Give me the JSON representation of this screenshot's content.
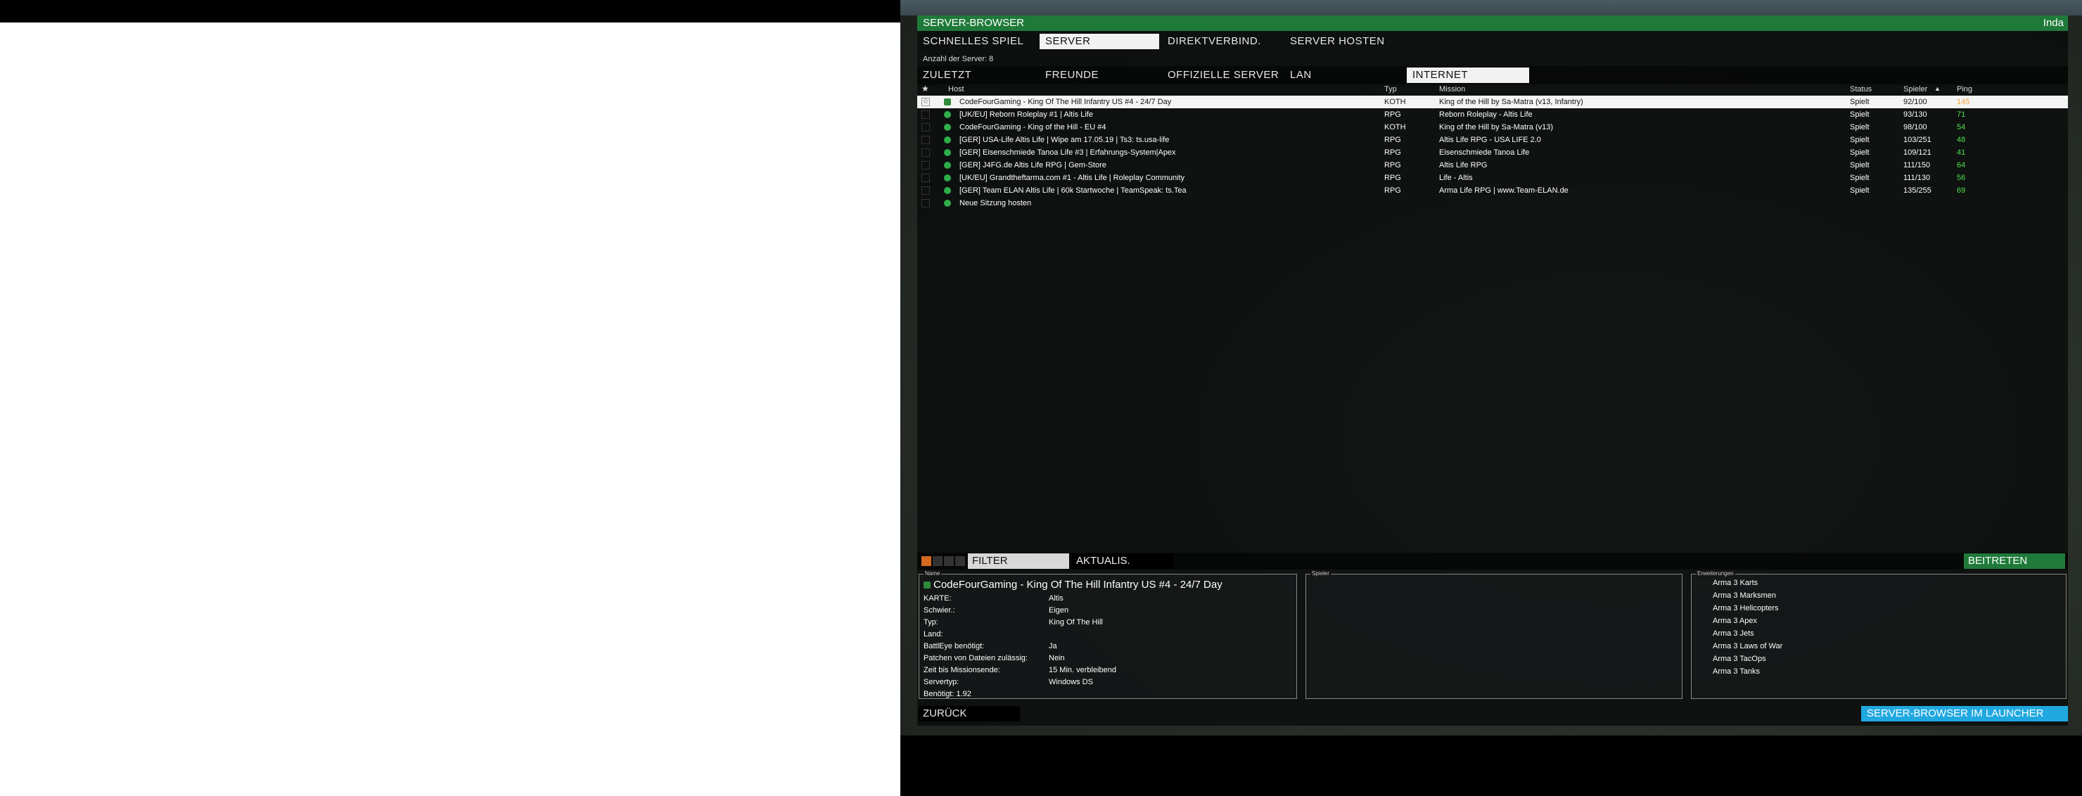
{
  "window": {
    "title": "SERVER-BROWSER",
    "user": "Inda"
  },
  "tabs_main": [
    {
      "label": "SCHNELLES SPIEL"
    },
    {
      "label": "SERVER"
    },
    {
      "label": "DIREKTVERBIND."
    },
    {
      "label": "SERVER HOSTEN"
    }
  ],
  "server_count": "Anzahl der Server: 8",
  "tabs_filter": [
    {
      "label": "ZULETZT"
    },
    {
      "label": "FREUNDE"
    },
    {
      "label": "OFFIZIELLE SERVER"
    },
    {
      "label": "LAN"
    },
    {
      "label": "INTERNET"
    }
  ],
  "columns": {
    "fav_icon": "star-icon",
    "host": "Host",
    "type": "Typ",
    "mission": "Mission",
    "status": "Status",
    "players": "Spieler",
    "ping": "Ping"
  },
  "rows": [
    {
      "host": "CodeFourGaming - King Of The Hill Infantry US #4 - 24/7 Day",
      "type": "KOTH",
      "mission": "King of the Hill by Sa-Matra (v13, Infantry)",
      "status": "Spielt",
      "players": "92/100",
      "ping": "145"
    },
    {
      "host": "[UK/EU] Reborn Roleplay #1 | Altis Life",
      "type": "RPG",
      "mission": "Reborn Roleplay - Altis Life",
      "status": "Spielt",
      "players": "93/130",
      "ping": "71"
    },
    {
      "host": "CodeFourGaming - King of the Hill - EU #4",
      "type": "KOTH",
      "mission": "King of the Hill by Sa-Matra (v13)",
      "status": "Spielt",
      "players": "98/100",
      "ping": "54"
    },
    {
      "host": "[GER] USA-Life Altis Life | Wipe am 17.05.19 | Ts3: ts.usa-life",
      "type": "RPG",
      "mission": "Altis Life RPG - USA LIFE 2.0",
      "status": "Spielt",
      "players": "103/251",
      "ping": "48"
    },
    {
      "host": "[GER] Eisenschmiede Tanoa Life #3 | Erfahrungs-System|Apex",
      "type": "RPG",
      "mission": "Eisenschmiede Tanoa Life",
      "status": "Spielt",
      "players": "109/121",
      "ping": "41"
    },
    {
      "host": "[GER] J4FG.de Altis Life RPG | Gem-Store",
      "type": "RPG",
      "mission": "Altis Life RPG",
      "status": "Spielt",
      "players": "111/150",
      "ping": "64"
    },
    {
      "host": "[UK/EU] Grandtheftarma.com #1 - Altis Life | Roleplay Community",
      "type": "RPG",
      "mission": "Life - Altis",
      "status": "Spielt",
      "players": "111/130",
      "ping": "56"
    },
    {
      "host": "[GER] Team ELAN Altis Life | 60k Startwoche | TeamSpeak: ts.Tea",
      "type": "RPG",
      "mission": "Arma Life RPG | www.Team-ELAN.de",
      "status": "Spielt",
      "players": "135/255",
      "ping": "69"
    },
    {
      "host": "Neue Sitzung hosten",
      "type": "",
      "mission": "",
      "status": "",
      "players": "",
      "ping": ""
    }
  ],
  "toolbar": {
    "filter": "FILTER",
    "refresh": "AKTUALIS.",
    "join": "BEITRETEN"
  },
  "details": {
    "panel_label": "Name",
    "hostname": "CodeFourGaming - King Of The Hill Infantry US #4 - 24/7 Day",
    "fields": [
      {
        "k": "KARTE:",
        "v": "Altis"
      },
      {
        "k": "Schwier.:",
        "v": "Eigen"
      },
      {
        "k": "Typ:",
        "v": "King Of The Hill"
      },
      {
        "k": "Land:",
        "v": ""
      },
      {
        "k": "BattlEye benötigt:",
        "v": "Ja"
      },
      {
        "k": "Patchen von Dateien zulässig:",
        "v": "Nein"
      },
      {
        "k": "Zeit bis Missionsende:",
        "v": "15 Min. verbleibend"
      },
      {
        "k": "Servertyp:",
        "v": "Windows DS"
      },
      {
        "k": "Benötigt: 1.92",
        "v": ""
      }
    ]
  },
  "middle_panel": {
    "label": "Spieler"
  },
  "dlc_panel": {
    "label": "Erweiterungen",
    "items": [
      "Arma 3 Karts",
      "Arma 3 Marksmen",
      "Arma 3 Helicopters",
      "Arma 3 Apex",
      "Arma 3 Jets",
      "Arma 3 Laws of War",
      "Arma 3 TacOps",
      "Arma 3 Tanks"
    ]
  },
  "footer": {
    "back": "ZURÜCK",
    "launcher": "SERVER-BROWSER IM LAUNCHER"
  }
}
